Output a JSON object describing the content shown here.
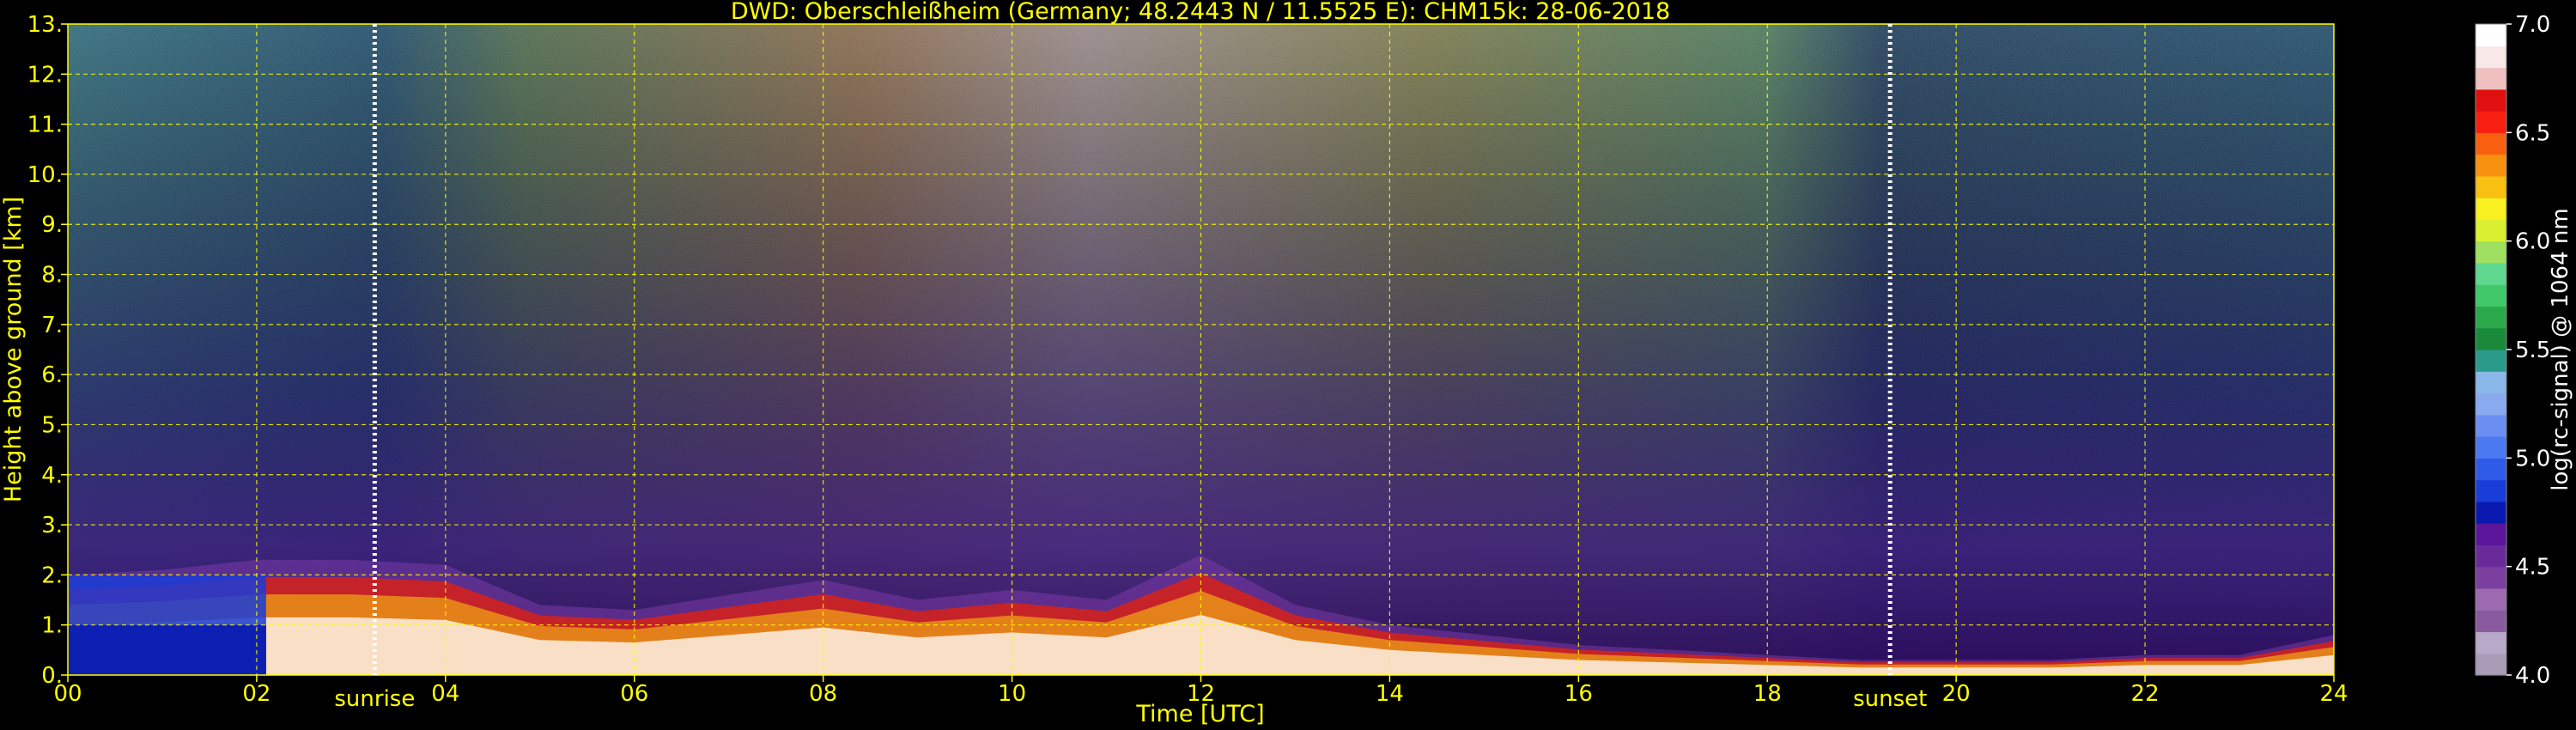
{
  "colors": {
    "background": "#000000",
    "text": "#ffff00",
    "grid": "#ffff00",
    "marker_line": "#ffffff",
    "colorbar_text": "#ffffff"
  },
  "chart_data": {
    "type": "heatmap",
    "title": "DWD: Oberschleißheim (Germany; 48.2443 N / 11.5525 E):    CHM15k: 28-06-2018",
    "xlabel": "Time [UTC]",
    "ylabel": "Height above ground [km]",
    "xlim": [
      0,
      24
    ],
    "ylim": [
      0,
      13
    ],
    "x_ticks": [
      0,
      2,
      4,
      6,
      8,
      10,
      12,
      14,
      16,
      18,
      20,
      22,
      24
    ],
    "x_tick_labels": [
      "00",
      "02",
      "04",
      "06",
      "08",
      "10",
      "12",
      "14",
      "16",
      "18",
      "20",
      "22",
      "24"
    ],
    "y_ticks": [
      0,
      1,
      2,
      3,
      4,
      5,
      6,
      7,
      8,
      9,
      10,
      11,
      12,
      13
    ],
    "y_tick_labels": [
      "0.",
      "1.",
      "2.",
      "3.",
      "4.",
      "5.",
      "6.",
      "7.",
      "8.",
      "9.",
      "10.",
      "11.",
      "12.",
      "13."
    ],
    "grid": true,
    "markers": [
      {
        "label": "sunrise",
        "time": 3.25
      },
      {
        "label": "sunset",
        "time": 19.3
      }
    ],
    "colorbar": {
      "label": "log(rc-signal) @ 1064 nm",
      "range": [
        4.0,
        7.0
      ],
      "ticks": [
        4.0,
        4.5,
        5.0,
        5.5,
        6.0,
        6.5,
        7.0
      ],
      "tick_labels": [
        "4.0",
        "4.5",
        "5.0",
        "5.5",
        "6.0",
        "6.5",
        "7.0"
      ],
      "colors": [
        "#a89cb8",
        "#b7a9c8",
        "#8a5aa0",
        "#9c6ab0",
        "#7b3fa0",
        "#6a2a9a",
        "#5a159a",
        "#0a1ab0",
        "#1a3cd8",
        "#2e5ae8",
        "#4a78f0",
        "#6a8ef2",
        "#8aaaf0",
        "#8ab8e8",
        "#2a9a8a",
        "#1a8a3a",
        "#2aa84a",
        "#40c86a",
        "#60d890",
        "#a0e060",
        "#d8f030",
        "#f8f020",
        "#f8c010",
        "#f89010",
        "#f86010",
        "#f82010",
        "#e01010",
        "#f0c0c0",
        "#f8e8e8",
        "#ffffff"
      ]
    },
    "features": [
      {
        "description_values": "boundary layer aerosol top (km) vs time (UTC)",
        "x": [
          0,
          1,
          2,
          3,
          4,
          5,
          6,
          7,
          8,
          9,
          10,
          11,
          12,
          13,
          14,
          15,
          16,
          17,
          18,
          19,
          20,
          21,
          22,
          23,
          24
        ],
        "y": [
          2.0,
          2.1,
          2.3,
          2.3,
          2.2,
          1.4,
          1.3,
          1.6,
          1.9,
          1.5,
          1.7,
          1.5,
          2.4,
          1.4,
          1.0,
          0.8,
          0.6,
          0.5,
          0.4,
          0.3,
          0.3,
          0.3,
          0.4,
          0.4,
          0.8
        ]
      }
    ]
  }
}
